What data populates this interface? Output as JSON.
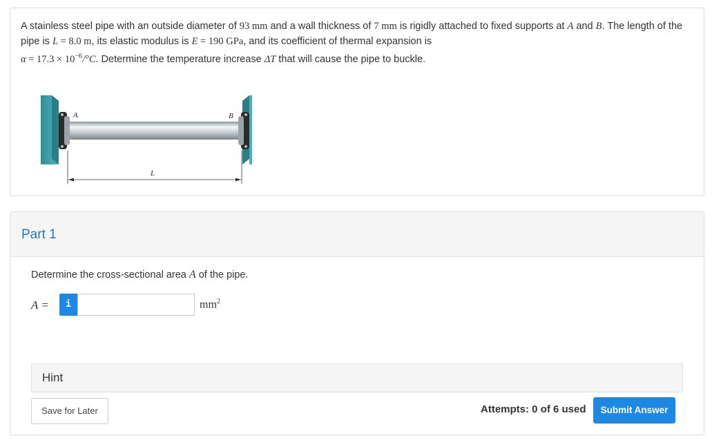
{
  "problem": {
    "t1": "A stainless steel pipe with an outside diameter of ",
    "d_val": "93 mm",
    "t2": " and a wall thickness of ",
    "w_val": "7 mm",
    "t3": " is rigidly attached to fixed supports at ",
    "pA": "A",
    "t4": " and ",
    "pB": "B",
    "t5": ". The length of the pipe is ",
    "L_sym": "L",
    "L_val": " = 8.0 m",
    "t6": ", its elastic modulus is ",
    "E_sym": "E",
    "E_val": " = 190  GPa",
    "t7": ", and its coefficient of thermal expansion is",
    "alpha_sym": "α",
    "alpha_val": " = 17.3 × 10",
    "alpha_exp": "−6",
    "alpha_unit": "/°C",
    "t8": ". Determine the temperature increase ",
    "dT_sym": "ΔT",
    "t9": " that will cause the pipe to buckle."
  },
  "figure": {
    "label_a": "A",
    "label_b": "B",
    "label_l": "L"
  },
  "part": {
    "title": "Part 1",
    "question_pre": "Determine the cross-sectional area ",
    "question_sym": "A",
    "question_post": " of the pipe.",
    "answer_label": "A =",
    "info_icon": "i",
    "answer_value": "",
    "unit_base": "mm",
    "unit_exp": "2",
    "hint": "Hint",
    "save": "Save for Later",
    "attempts": "Attempts: 0 of 6 used",
    "submit": "Submit Answer"
  },
  "colors": {
    "accent": "#1e88e5",
    "part_title": "#2077c6",
    "support": "#3aa3ad"
  }
}
